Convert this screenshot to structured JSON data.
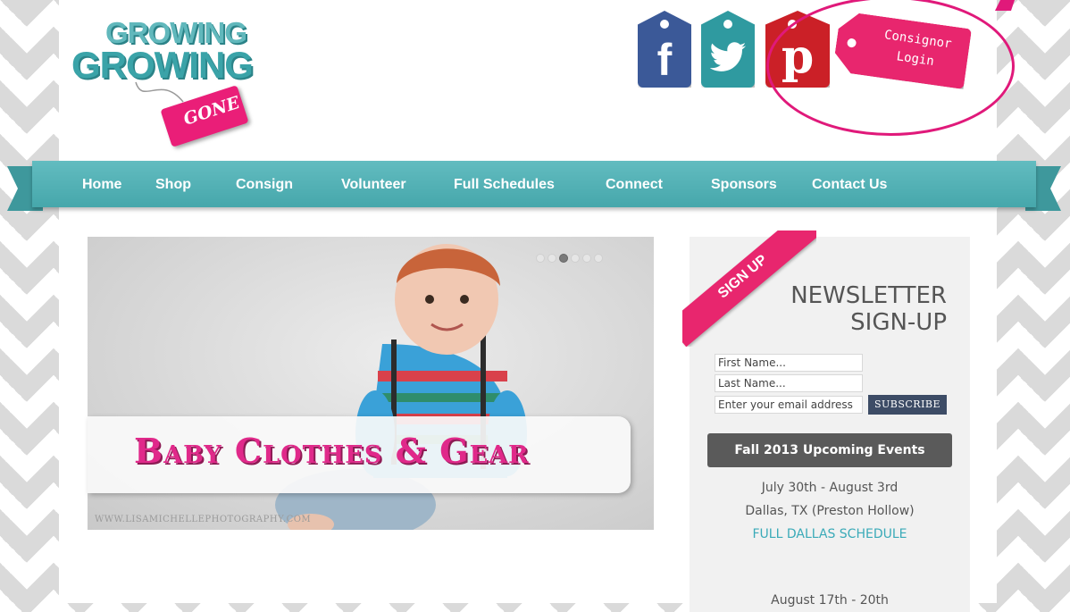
{
  "logo": {
    "line1": "GROWING",
    "line2": "GROWING",
    "tag": "GONE"
  },
  "social": {
    "facebook": "f",
    "pinterest": "p"
  },
  "consignor_login": {
    "line1": "Consignor",
    "line2": "Login"
  },
  "nav": [
    "Home",
    "Shop",
    "Consign",
    "Volunteer",
    "Full Schedules",
    "Connect",
    "Sponsors",
    "Contact Us"
  ],
  "slider": {
    "caption": "Baby Clothes & Gear",
    "watermark": "WWW.LISAMICHELLEPHOTOGRAPHY.COM",
    "dot_count": 6,
    "active_dot": 3
  },
  "newsletter": {
    "ribbon": "SIGN UP",
    "title_line1": "NEWSLETTER",
    "title_line2": "SIGN-UP",
    "first_name_placeholder": "First Name...",
    "last_name_placeholder": "Last Name...",
    "email_placeholder": "Enter your email address",
    "subscribe_label": "SUBSCRIBE"
  },
  "events": {
    "heading": "Fall 2013 Upcoming Events",
    "items": [
      {
        "dates": "July 30th - August 3rd",
        "location": "Dallas, TX (Preston Hollow)",
        "link": "FULL DALLAS SCHEDULE"
      },
      {
        "dates": "August 17th - 20th"
      }
    ]
  },
  "colors": {
    "teal": "#4aa9ad",
    "pink": "#e8266e",
    "facebook": "#3b5998",
    "pinterest": "#cb2027"
  }
}
